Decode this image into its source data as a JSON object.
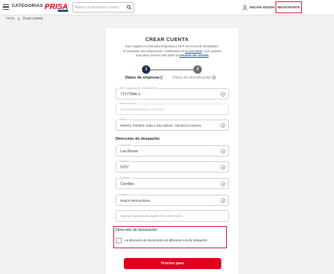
{
  "header": {
    "categories_label": "CATEGORIAS",
    "logo_text": "PRISA",
    "search_placeholder": "Buscar un producto o marca",
    "login_label": "INICIAR SESIÓN",
    "register_label": "REGISTRARTE"
  },
  "breadcrumb": {
    "home": "Inicio",
    "current": "Crear cuenta"
  },
  "form": {
    "title": "CREAR CUENTA",
    "intro_line1": "Este registro es sólo para Empresas y RUT con inicio de actividades.",
    "intro_line2_a": "Si necesitas más información, contáctanos al ",
    "intro_phone": "22 820 6000",
    "intro_line2_b": " o si lo quieres",
    "intro_line3_a": "sólo para conocer más sobre la ",
    "intro_link": "creación de cuentas",
    "steps": [
      {
        "number": "1",
        "label": "Datos de empresa",
        "active": true
      },
      {
        "number": "2",
        "label": "Datos de identificación",
        "active": false
      }
    ],
    "fields": {
      "rut": {
        "label": "RUT empresa (Ej. 76543210-9)*",
        "value": "77177846-1"
      },
      "razon": {
        "label": "Razón social *",
        "value": "ECOINVERSIONES LIMITADA"
      },
      "rubro": {
        "label": "Rubro *",
        "value": "Minería, Petróleo crudo y Gas natural - Servicios Conexos"
      },
      "direccion": {
        "label": "Dirección *",
        "value": "Las Rosas"
      },
      "numero": {
        "label": "Número *",
        "value": "5757"
      },
      "comuna": {
        "label": "Comuna *",
        "value": "Cerrillos"
      },
      "region": {
        "label": "Región",
        "value": "Región Metropolitana"
      },
      "extra": {
        "placeholder": "Agregar datos adicionales de la Dirección"
      }
    },
    "shipping_section": "Dirección de despacho",
    "billing": {
      "title": "Dirección de facturación",
      "checkbox_label": "La dirección de facturación es diferente a la de despacho",
      "checked": false
    },
    "submit_label": "Próximo paso"
  },
  "colors": {
    "accent_red": "#e1001d",
    "step_active": "#1d2b4b",
    "check_green": "#2e9e44",
    "link_blue": "#1a4fa0"
  }
}
